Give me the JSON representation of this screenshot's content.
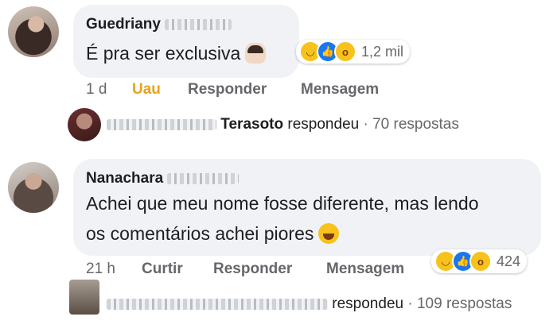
{
  "comments": [
    {
      "author_first": "Guedriany",
      "text": "É pra ser exclusiva",
      "reaction_count": "1,2 mil",
      "actions": {
        "time": "1 d",
        "reaction": "Uau",
        "reply": "Responder",
        "message": "Mensagem"
      },
      "reply_summary": {
        "name": "Terasoto",
        "verb": "respondeu",
        "count": "· 70 respostas"
      }
    },
    {
      "author_first": "Nanachara",
      "text_line1": "Achei que meu nome fosse diferente, mas lendo",
      "text_line2": "os comentários achei piores",
      "reaction_count": "424",
      "actions": {
        "time": "21 h",
        "reaction": "Curtir",
        "reply": "Responder",
        "message": "Mensagem"
      },
      "reply_summary": {
        "verb": "respondeu",
        "count": "· 109 respostas"
      }
    }
  ],
  "icons": [
    "haha-reaction-icon",
    "like-reaction-icon",
    "wow-reaction-icon",
    "laughing-emoji-icon",
    "tipping-hand-emoji-icon"
  ],
  "colors": {
    "uau": "#e9a21c",
    "like": "#1877f2",
    "bubble": "#f0f2f5",
    "muted": "#65676b"
  }
}
